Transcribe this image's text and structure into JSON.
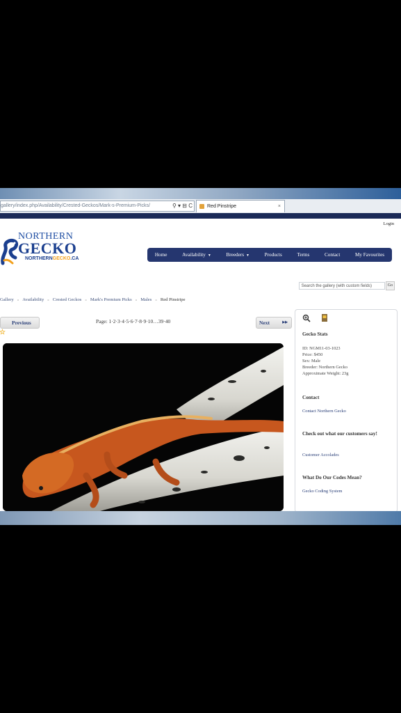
{
  "browser": {
    "url": "gallery/index.php/Availability/Crested-Geckos/Mark-s-Premium-Picks/",
    "url_icons": "⚲ ▾ ⊟ C",
    "tab_title": "Red Pinstripe",
    "tab_close": "×"
  },
  "header": {
    "login": "Login",
    "logo_top": "NORTHERN",
    "logo_main": "GECKO",
    "logo_sub_a": "NORTHERN",
    "logo_sub_b": "GECKO",
    "logo_sub_c": ".CA"
  },
  "nav": {
    "items": [
      "Home",
      "Availability",
      "Breeders",
      "Products",
      "Terms",
      "Contact",
      "My Favourites"
    ]
  },
  "search": {
    "placeholder": "Search the gallery (with custom fields)",
    "button": "Go"
  },
  "breadcrumb": {
    "items": [
      "Gallery",
      "Availability",
      "Crested Geckos",
      "Mark's Premium Picks",
      "Males"
    ],
    "current": "Red Pinstripe",
    "separator": "»"
  },
  "pagination": {
    "previous": "Previous",
    "next": "Next",
    "pages_text": "Page: 1·2·3·4·5·6·7·8·9·10…39·40"
  },
  "sidebar": {
    "stats_heading": "Gecko Stats",
    "id": "ID: NGM11-03-1023",
    "price": "Price: $450",
    "sex": "Sex: Male",
    "breeder": "Breeder: Northern Gecko",
    "weight": "Approximate Weight: 23g",
    "contact_heading": "Contact",
    "contact_link": "Contact Northern Gecko",
    "customers_heading": "Check out what our customers say!",
    "customers_link": "Customer Accolades",
    "codes_heading": "What Do Our Codes Mean?",
    "codes_link": "Gecko Coding System"
  },
  "colors": {
    "nav_bg": "#25366f",
    "brand_blue": "#1b3f8f",
    "brand_orange": "#f2a01c",
    "link": "#2a3f78"
  },
  "icons": {
    "zoom": "zoom-in-icon",
    "fav": "favourite-icon",
    "prev": "star-icon",
    "next": "double-arrow-right-icon"
  }
}
